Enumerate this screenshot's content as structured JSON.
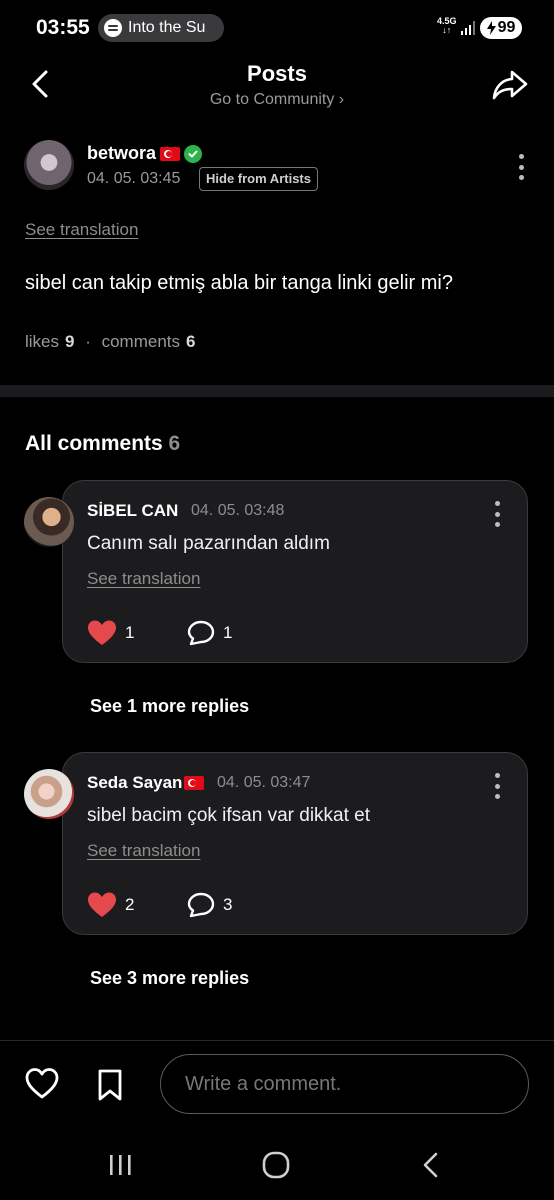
{
  "status_bar": {
    "time": "03:55",
    "media_text": "Into the Su",
    "network_label": "4.5G",
    "battery": "99"
  },
  "header": {
    "title": "Posts",
    "subtitle": "Go to Community ›"
  },
  "post": {
    "author": "betwora",
    "date": "04. 05. 03:45",
    "hide_label": "Hide from Artists",
    "see_translation": "See translation",
    "body": "sibel can takip etmiş abla bir tanga linki gelir mi?",
    "likes_label": "likes",
    "likes_count": "9",
    "comments_label": "comments",
    "comments_count": "6"
  },
  "comments_section": {
    "title": "All comments",
    "count": "6",
    "items": [
      {
        "author": "SİBEL CAN",
        "date": "04. 05. 03:48",
        "text": "Canım salı pazarından aldım",
        "see_translation": "See translation",
        "likes": "1",
        "replies": "1",
        "more_replies": "See 1 more replies"
      },
      {
        "author": "Seda Sayan",
        "date": "04. 05. 03:47",
        "text": "sibel bacim çok ifsan var dikkat et",
        "see_translation": "See translation",
        "likes": "2",
        "replies": "3",
        "more_replies": "See 3 more replies"
      }
    ]
  },
  "composer": {
    "placeholder": "Write a comment."
  },
  "colors": {
    "background": "#000000",
    "card": "#1c1c1e",
    "heart": "#e5484d",
    "verified": "#2fb14b",
    "muted": "#8d8d8d"
  },
  "icons": [
    "back-icon",
    "share-icon",
    "verified-icon",
    "kebab-icon",
    "heart-icon",
    "comment-icon",
    "bookmark-icon",
    "recents-icon",
    "home-icon",
    "nav-back-icon"
  ]
}
